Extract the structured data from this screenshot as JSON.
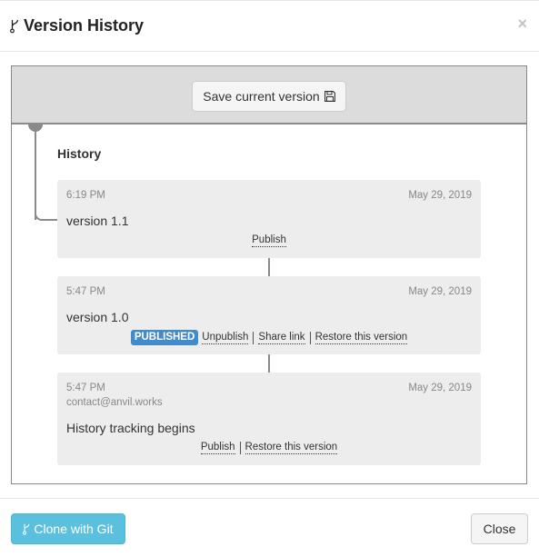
{
  "dialog": {
    "title": "Version History",
    "title_icon": "git-fork-icon",
    "close_glyph": "×"
  },
  "save": {
    "label": "Save current version",
    "icon": "floppy-disk-icon"
  },
  "history": {
    "heading": "History",
    "versions": [
      {
        "time": "6:19 PM",
        "date": "May 29, 2019",
        "author": "",
        "description": "version 1.1",
        "published": false,
        "actions": [
          "Publish"
        ]
      },
      {
        "time": "5:47 PM",
        "date": "May 29, 2019",
        "author": "",
        "description": "version 1.0",
        "published": true,
        "badge": "PUBLISHED",
        "actions": [
          "Unpublish",
          "Share link",
          "Restore this version"
        ]
      },
      {
        "time": "5:47 PM",
        "date": "May 29, 2019",
        "author": "contact@anvil.works",
        "description": "History tracking begins",
        "published": false,
        "actions": [
          "Publish",
          "Restore this version"
        ]
      }
    ]
  },
  "footer": {
    "clone_label": "Clone with Git",
    "clone_icon": "git-fork-icon",
    "close_label": "Close"
  },
  "colors": {
    "badge": "#428bca",
    "clone_button": "#5bc0de",
    "card_bg": "#ededed",
    "save_area_bg": "#dcdcdc",
    "timeline": "#8a8a8a"
  }
}
